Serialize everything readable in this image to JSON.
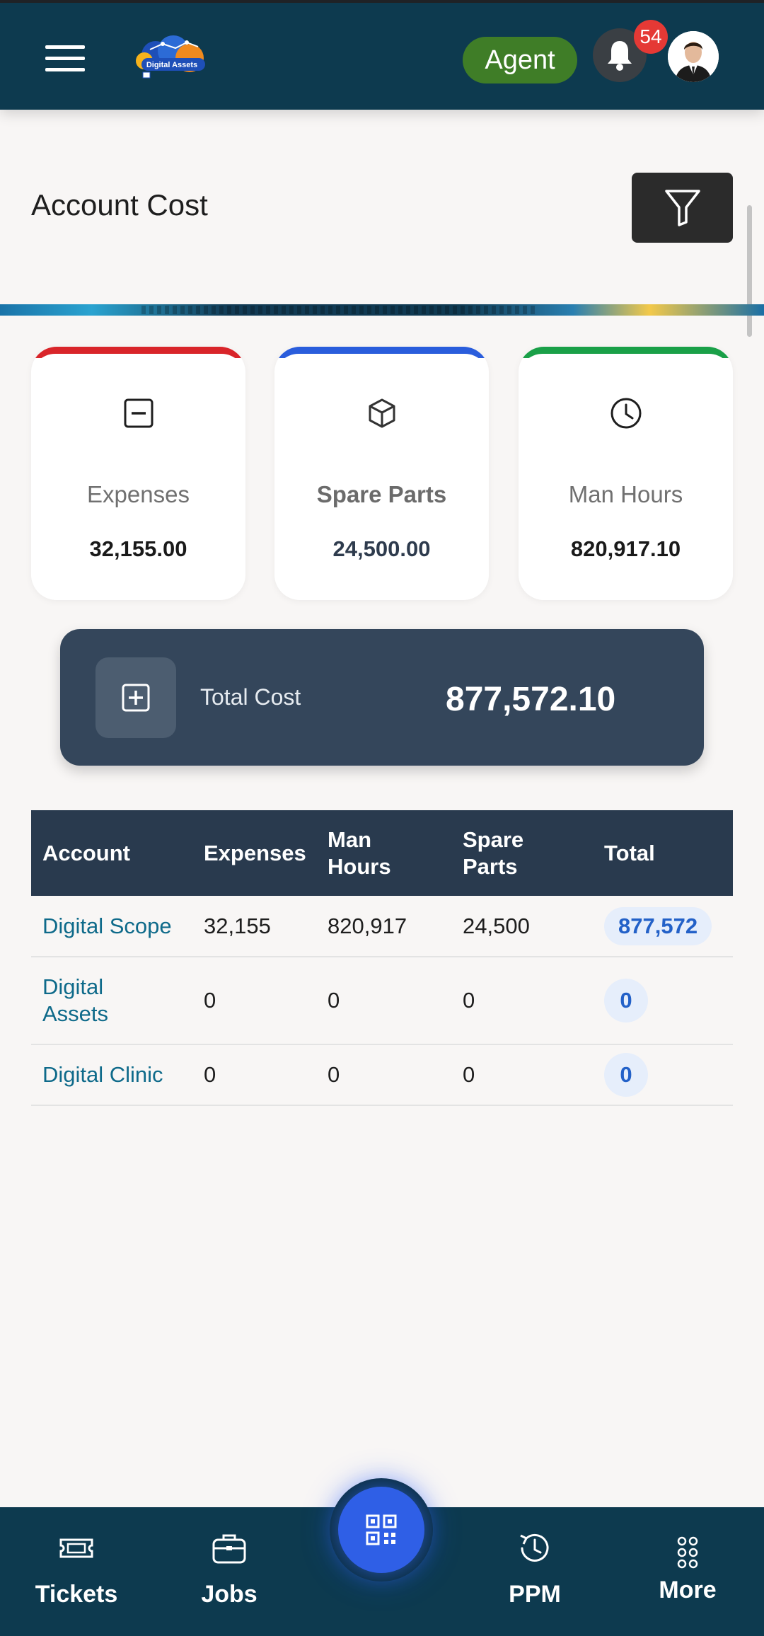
{
  "header": {
    "app_name": "Digital Assets",
    "role_label": "Agent",
    "notification_count": "54"
  },
  "page": {
    "title": "Account Cost"
  },
  "stats": {
    "expenses": {
      "label": "Expenses",
      "value": "32,155.00",
      "accent": "#d9252a"
    },
    "spare_parts": {
      "label": "Spare Parts",
      "value": "24,500.00",
      "accent": "#2a5ddc"
    },
    "man_hours": {
      "label": "Man Hours",
      "value": "820,917.10",
      "accent": "#1aa048"
    }
  },
  "total": {
    "label": "Total Cost",
    "value": "877,572.10"
  },
  "table": {
    "columns": [
      "Account",
      "Expenses",
      "Man Hours",
      "Spare Parts",
      "Total"
    ],
    "rows": [
      {
        "account": "Digital Scope",
        "expenses": "32,155",
        "man_hours": "820,917",
        "spare_parts": "24,500",
        "total": "877,572"
      },
      {
        "account": "Digital Assets",
        "expenses": "0",
        "man_hours": "0",
        "spare_parts": "0",
        "total": "0"
      },
      {
        "account": "Digital Clinic",
        "expenses": "0",
        "man_hours": "0",
        "spare_parts": "0",
        "total": "0"
      }
    ]
  },
  "bottom_nav": {
    "tickets": "Tickets",
    "jobs": "Jobs",
    "ppm": "PPM",
    "more": "More"
  },
  "icons": {
    "menu": "hamburger-icon",
    "bell": "bell-icon",
    "filter": "filter-icon",
    "expenses": "minus-square-icon",
    "spare_parts": "cube-icon",
    "man_hours": "clock-icon",
    "total": "plus-square-icon",
    "qr": "qr-code-icon"
  },
  "colors": {
    "top_bar": "#0d3a4f",
    "total_card": "#34465b",
    "table_header": "#293a4e",
    "agent_pill": "#3f7d27",
    "fab": "#2f5fe6"
  }
}
